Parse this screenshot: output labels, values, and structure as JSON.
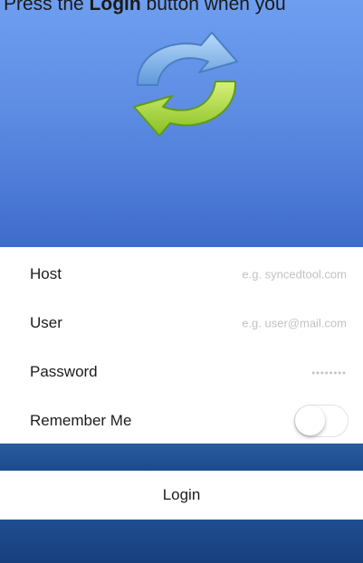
{
  "caption": {
    "prefix": "Press the ",
    "bold": "Login",
    "suffix": " button when you"
  },
  "header": {
    "logo_icon": "sync-arrows-icon",
    "colors": {
      "top": "#6e9ef0",
      "bottom": "#3f6ccc",
      "arrow_blue": "#7fb0e6",
      "arrow_green": "#9fd33a"
    }
  },
  "form": {
    "host": {
      "label": "Host",
      "placeholder": "e.g. syncedtool.com",
      "value": ""
    },
    "user": {
      "label": "User",
      "placeholder": "e.g. user@mail.com",
      "value": ""
    },
    "password": {
      "label": "Password",
      "placeholder": "••••••••",
      "value": ""
    },
    "remember": {
      "label": "Remember Me",
      "on": false
    }
  },
  "login": {
    "label": "Login"
  },
  "colors": {
    "band": "#1d4a8e",
    "text": "#1c1c1c",
    "placeholder": "#c2c2c2"
  }
}
